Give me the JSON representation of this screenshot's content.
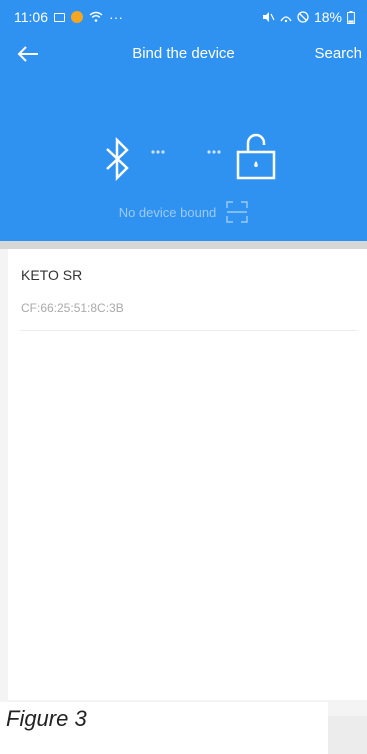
{
  "status_bar": {
    "time": "11:06",
    "battery": "18%",
    "overflow": "···",
    "icons": [
      "image-icon",
      "app-notification-icon",
      "wifi-icon",
      "mute-icon",
      "signal-icon",
      "no-disturb-icon",
      "battery-icon"
    ]
  },
  "header": {
    "title": "Bind the device",
    "search_label": "Search",
    "back_icon": "arrow-left-icon",
    "status_text": "No device bound",
    "dots_left": "···",
    "dots_right": "···"
  },
  "devices": [
    {
      "name": "KETO SR",
      "mac": "CF:66:25:51:8C:3B"
    }
  ],
  "caption": "Figure 3",
  "colors": {
    "primary": "#2f92f0",
    "background": "#f4f4f4",
    "muted_text": "#9ccaf5"
  }
}
